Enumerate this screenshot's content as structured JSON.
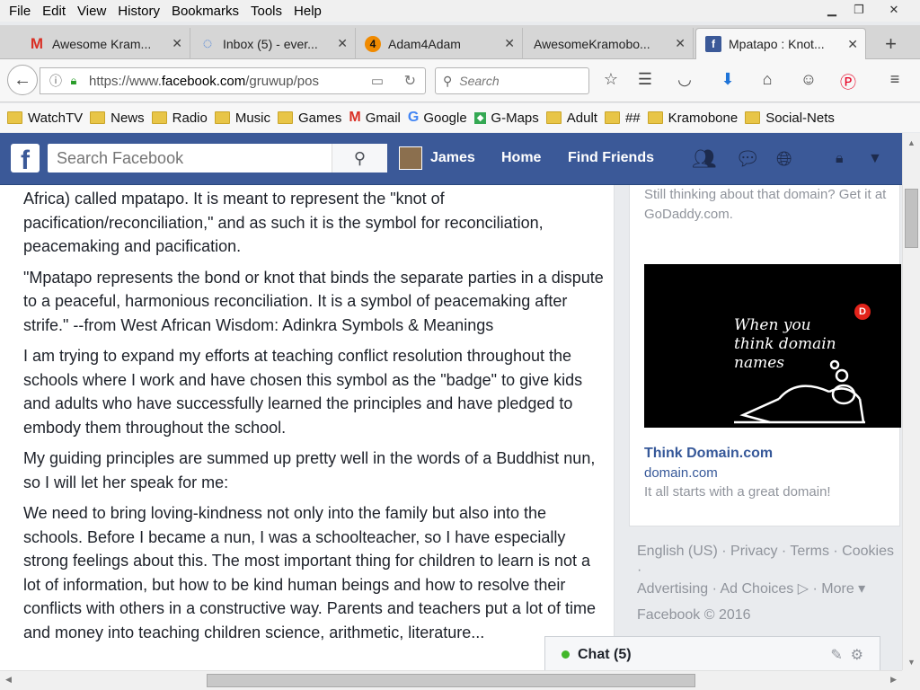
{
  "menubar": {
    "items": [
      {
        "u": "F",
        "rest": "ile"
      },
      {
        "u": "E",
        "rest": "dit"
      },
      {
        "u": "V",
        "rest": "iew"
      },
      {
        "u": "",
        "pre": "Hi",
        "u2": "s",
        "rest": "tory"
      },
      {
        "u": "B",
        "rest": "ookmarks"
      },
      {
        "u": "T",
        "rest": "ools"
      },
      {
        "u": "H",
        "rest": "elp"
      }
    ],
    "labels": [
      "File",
      "Edit",
      "View",
      "History",
      "Bookmarks",
      "Tools",
      "Help"
    ]
  },
  "tabs": [
    {
      "label": "Awesome Kram...",
      "icon": "gmail-icon",
      "glyph": "M",
      "color": "#d93025"
    },
    {
      "label": "Inbox (5) - ever...",
      "icon": "loading-icon",
      "glyph": "◌",
      "color": "#3a78d8"
    },
    {
      "label": "Adam4Adam",
      "icon": "adam4adam-icon",
      "glyph": "4",
      "color": "#f08a00"
    },
    {
      "label": "AwesomeKramobo...",
      "icon": "",
      "glyph": "",
      "color": ""
    },
    {
      "label": "Mpatapo : Knot...",
      "icon": "facebook-icon",
      "glyph": "f",
      "color": "#3b5998",
      "active": true
    }
  ],
  "navbar": {
    "url_prefix": "https://www.",
    "url_domain": "facebook.com",
    "url_path": "/gruwup/pos",
    "search_placeholder": "Search"
  },
  "bookmarks": [
    {
      "label": "WatchTV",
      "icon": "folder-icon"
    },
    {
      "label": "News",
      "icon": "folder-icon"
    },
    {
      "label": "Radio",
      "icon": "folder-icon"
    },
    {
      "label": "Music",
      "icon": "folder-icon"
    },
    {
      "label": "Games",
      "icon": "folder-icon"
    },
    {
      "label": "Gmail",
      "icon": "gmail-icon"
    },
    {
      "label": "Google",
      "icon": "google-icon"
    },
    {
      "label": "G-Maps",
      "icon": "maps-icon"
    },
    {
      "label": "Adult",
      "icon": "folder-icon"
    },
    {
      "label": "##",
      "icon": "folder-icon"
    },
    {
      "label": "Kramobone",
      "icon": "folder-icon"
    },
    {
      "label": "Social-Nets",
      "icon": "folder-icon"
    }
  ],
  "fbheader": {
    "search_placeholder": "Search Facebook",
    "user": "James",
    "home": "Home",
    "find_friends": "Find Friends"
  },
  "post": {
    "paragraphs": [
      "Africa) called mpatapo. It is meant to represent the \"knot of pacification/reconciliation,\" and as such it is the symbol for reconciliation, peacemaking and pacification.",
      "\"Mpatapo represents the bond or knot that binds the separate parties in a dispute to a peaceful, harmonious reconciliation. It is a symbol of peacemaking after strife.\" --from West African Wisdom: Adinkra Symbols & Meanings",
      "I am trying to expand my efforts at teaching conflict resolution throughout the schools where I work and have chosen this symbol as the \"badge\" to give kids and adults who have successfully learned the principles and have pledged to embody them throughout the school.",
      "My guiding principles are summed up pretty well in the words of a Buddhist nun, so I will let her speak for me:",
      "We need to bring loving-kindness not only into the family but also into the schools. Before I became a nun, I was a schoolteacher, so I have especially strong feelings about this. The most important thing for children to learn is not a lot of information, but how to be kind human beings and how to resolve their conflicts with others in a constructive way. Parents and teachers put a lot of time and money into teaching children science, arithmetic, literature..."
    ]
  },
  "ad": {
    "top_text": "Still thinking about that domain? Get it at GoDaddy.com.",
    "image_text": "When you think domain names",
    "image_badge": "D",
    "title": "Think Domain.com",
    "domain": "domain.com",
    "description": "It all starts with a great domain!"
  },
  "footer": {
    "line1": "English (US) · Privacy · Terms · Cookies ·",
    "line2": "Advertising · Ad Choices ▷ · More ▾",
    "copyright": "Facebook © 2016"
  },
  "chat": {
    "label": "Chat (5)"
  }
}
